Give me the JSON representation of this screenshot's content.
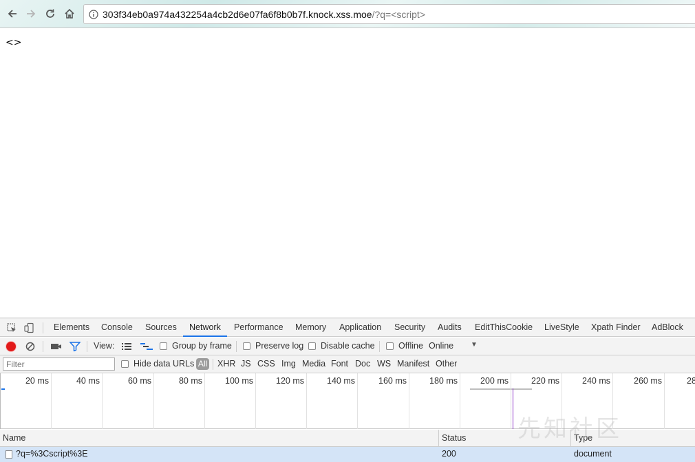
{
  "browser": {
    "url_host": "303f34eb0a974a432254a4cb2d6e07fa6f8b0b7f.knock.xss.moe",
    "url_path": "/?q=<script>"
  },
  "page": {
    "body_text": "<>"
  },
  "devtools": {
    "tabs": [
      {
        "label": "Elements"
      },
      {
        "label": "Console"
      },
      {
        "label": "Sources"
      },
      {
        "label": "Network"
      },
      {
        "label": "Performance"
      },
      {
        "label": "Memory"
      },
      {
        "label": "Application"
      },
      {
        "label": "Security"
      },
      {
        "label": "Audits"
      },
      {
        "label": "EditThisCookie"
      },
      {
        "label": "LiveStyle"
      },
      {
        "label": "Xpath Finder"
      },
      {
        "label": "AdBlock"
      }
    ],
    "active_tab": "Network",
    "toolbar": {
      "view_label": "View:",
      "group_by_frame": "Group by frame",
      "preserve_log": "Preserve log",
      "disable_cache": "Disable cache",
      "offline": "Offline",
      "throttle": "Online"
    },
    "filterbar": {
      "filter_placeholder": "Filter",
      "hide_data_urls": "Hide data URLs",
      "all": "All",
      "types": [
        "XHR",
        "JS",
        "CSS",
        "Img",
        "Media",
        "Font",
        "Doc",
        "WS",
        "Manifest",
        "Other"
      ]
    },
    "timeline": {
      "ticks": [
        "20 ms",
        "40 ms",
        "60 ms",
        "80 ms",
        "100 ms",
        "120 ms",
        "140 ms",
        "160 ms",
        "180 ms",
        "200 ms",
        "220 ms",
        "240 ms",
        "260 ms",
        "28"
      ]
    },
    "table": {
      "headers": {
        "name": "Name",
        "status": "Status",
        "type": "Type"
      },
      "rows": [
        {
          "name": "?q=%3Cscript%3E",
          "status": "200",
          "type": "document"
        }
      ]
    },
    "colors": {
      "record": "#e21a1a",
      "filter_active": "#1a73e8",
      "load_line": "#8b2fc9"
    }
  },
  "watermark": "先知社区"
}
